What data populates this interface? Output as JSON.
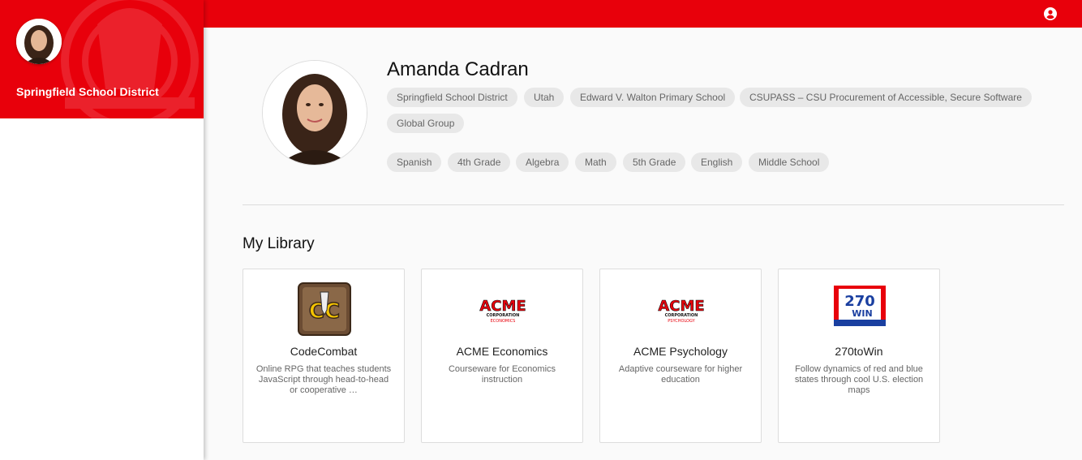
{
  "topbar": {
    "account_icon": "account-circle-icon",
    "color": "#e8000b"
  },
  "sidebar": {
    "district_name": "Springfield School District",
    "avatar_icon": "user-avatar"
  },
  "profile": {
    "name": "Amanda Cadran",
    "org_tags": [
      "Springfield School District",
      "Utah",
      "Edward V. Walton Primary School",
      "CSUPASS – CSU Procurement of Accessible, Secure Software",
      "Global Group"
    ],
    "subject_tags": [
      "Spanish",
      "4th Grade",
      "Algebra",
      "Math",
      "5th Grade",
      "English",
      "Middle School"
    ]
  },
  "library": {
    "title": "My Library",
    "apps": [
      {
        "name": "CodeCombat",
        "description": "Online RPG that teaches students JavaScript through head-to-head or cooperative …",
        "logo_text": "CC"
      },
      {
        "name": "ACME Economics",
        "description": "Courseware for Economics instruction",
        "logo_text": "ACME",
        "logo_sub1": "CORPORATION",
        "logo_sub2": "ECONOMICS"
      },
      {
        "name": "ACME Psychology",
        "description": "Adaptive courseware for higher education",
        "logo_text": "ACME",
        "logo_sub1": "CORPORATION",
        "logo_sub2": "PSYCHOLOGY"
      },
      {
        "name": "270toWin",
        "description": "Follow dynamics of red and blue states through cool U.S. election maps",
        "logo_text": "270",
        "logo_sub1": "WIN"
      }
    ]
  }
}
